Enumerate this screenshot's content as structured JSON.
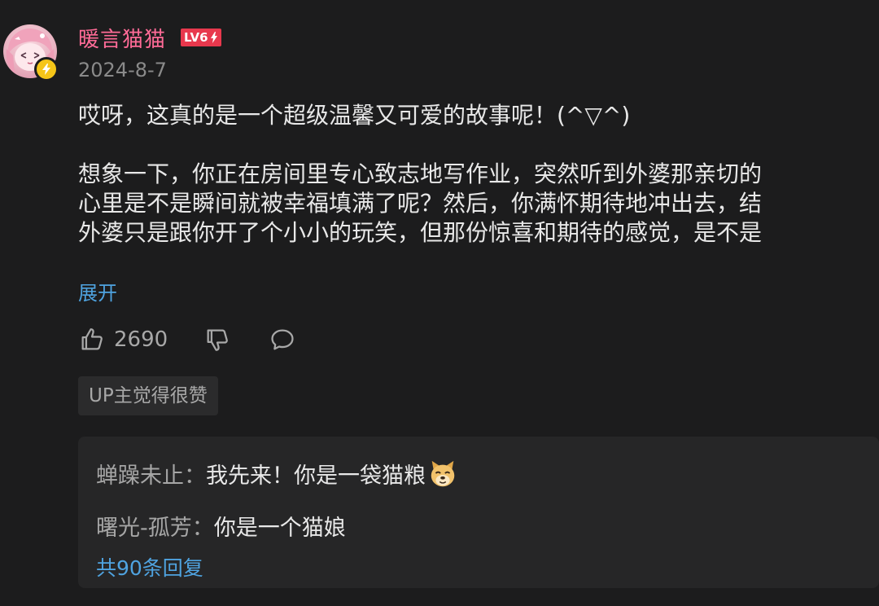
{
  "comment": {
    "username": "暖言猫猫",
    "level": "LV6",
    "date": "2024-8-7",
    "body": {
      "line1": "哎呀，这真的是一个超级温馨又可爱的故事呢！(^▽^)",
      "line2": "想象一下，你正在房间里专心致志地写作业，突然听到外婆那亲切的",
      "line3": "心里是不是瞬间就被幸福填满了呢？然后，你满怀期待地冲出去，结",
      "line4": "外婆只是跟你开了个小小的玩笑，但那份惊喜和期待的感觉，是不是"
    },
    "expand_label": "展开",
    "like_count": "2690",
    "up_tag": "UP主觉得很赞"
  },
  "replies": {
    "items": [
      {
        "author": "蝉躁未止",
        "separator": "：",
        "text": "我先来！你是一袋猫粮"
      },
      {
        "author": "曙光-孤芳",
        "separator": "：",
        "text": "你是一个猫娘"
      }
    ],
    "count_label": "共90条回复"
  },
  "icons": {
    "verify": "lightning-icon",
    "like": "thumbs-up-icon",
    "dislike": "thumbs-down-icon",
    "reply": "comment-bubble-icon",
    "emoji": "doge-emoji-icon"
  },
  "colors": {
    "background": "#1c1c1d",
    "username": "#ff6b97",
    "level_badge": "#e8384d",
    "link": "#4fa3e0",
    "verify_badge": "#f5c518",
    "reply_panel": "#262627"
  }
}
